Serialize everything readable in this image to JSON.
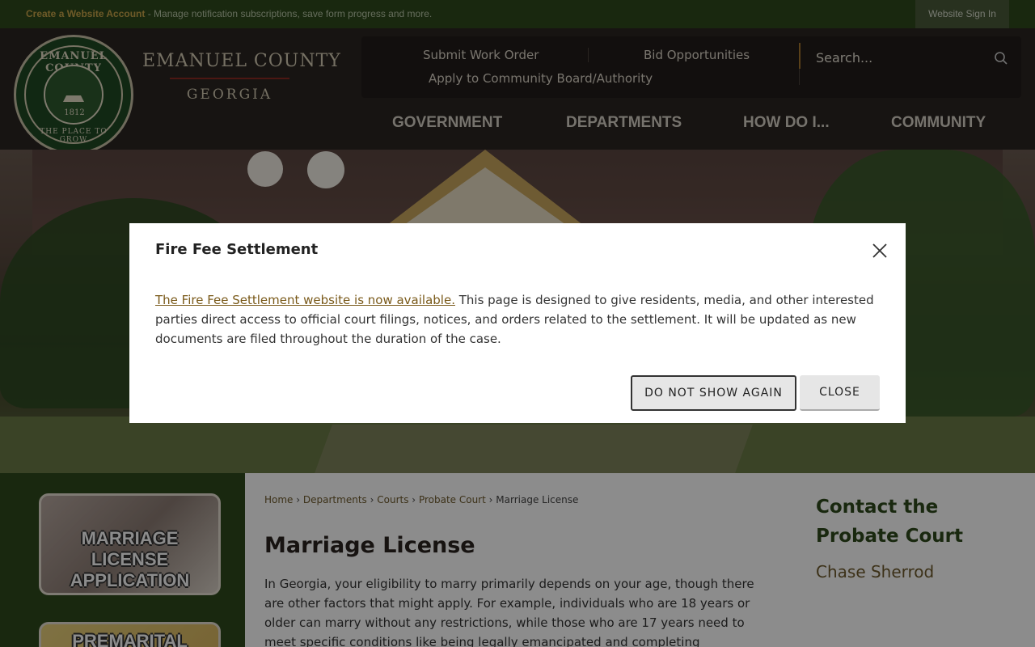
{
  "topbar": {
    "create_account": "Create a Website Account",
    "create_account_desc": " - Manage notification subscriptions, save form progress and more.",
    "sign_in": "Website Sign In"
  },
  "header": {
    "seal": {
      "top_text": "EMANUEL COUNTY",
      "bottom_text": "THE PLACE TO GROW",
      "year": "1812"
    },
    "brand_name": "EMANUEL COUNTY",
    "brand_state": "GEORGIA",
    "quick_links": [
      "Submit Work Order",
      "Bid Opportunities",
      "Apply to Community Board/Authority"
    ],
    "search_placeholder": "Search...",
    "nav": [
      "GOVERNMENT",
      "DEPARTMENTS",
      "HOW DO I...",
      "COMMUNITY"
    ]
  },
  "sidebar": {
    "tiles": [
      "MARRIAGE LICENSE APPLICATION",
      "PREMARITAL"
    ]
  },
  "breadcrumb": [
    "Home",
    "Departments",
    "Courts",
    "Probate Court",
    "Marriage License"
  ],
  "breadcrumb_sep": "›",
  "page": {
    "title": "Marriage License",
    "body": "In Georgia, your eligibility to marry primarily depends on your age, though there are other factors that might apply. For example, individuals who are 18 years or older can marry without any restrictions, while those who are 17 years need to meet specific conditions like being legally emancipated and completing premarital counseling with"
  },
  "contact": {
    "heading": "Contact the Probate Court",
    "name": "Chase Sherrod"
  },
  "modal": {
    "title": "Fire Fee Settlement",
    "link_text": "The Fire Fee Settlement website is now available.",
    "body": " This page is designed to give residents, media, and other interested parties direct access to official court filings, notices, and orders related to the settlement. It will be updated as new documents are filed throughout the duration of the case.",
    "dont_show_label": "DO NOT SHOW AGAIN",
    "close_label": "CLOSE",
    "close_icon": "close-icon"
  },
  "colors": {
    "topbar": "#2f4a1c",
    "header": "#2b2521",
    "accent_gold": "#c9a44a",
    "brand_green": "#2f4a1c"
  }
}
